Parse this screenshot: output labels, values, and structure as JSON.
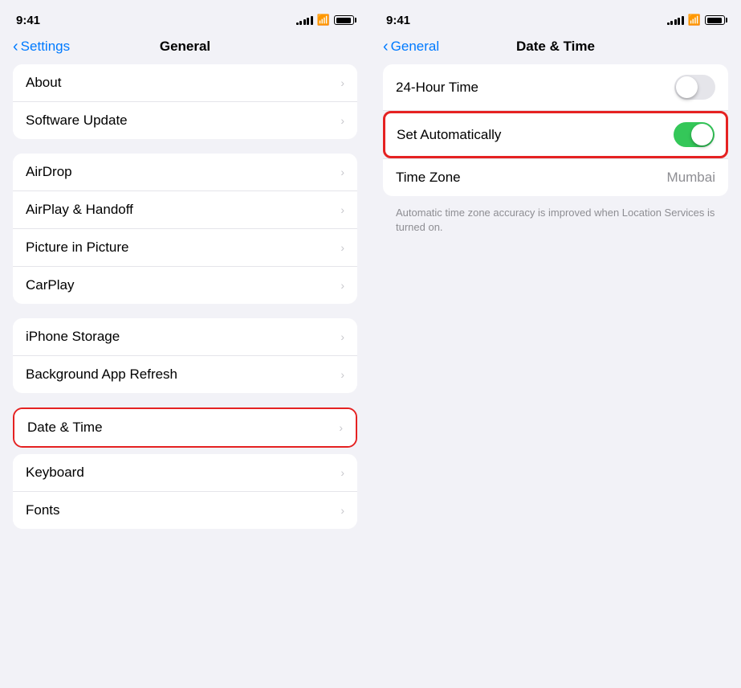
{
  "left_panel": {
    "status_bar": {
      "time": "9:41",
      "signal_bars": [
        3,
        5,
        7,
        9,
        11
      ],
      "wifi": "wifi",
      "battery": "battery"
    },
    "nav": {
      "back_label": "Settings",
      "title": "General"
    },
    "groups": [
      {
        "id": "group1",
        "items": [
          {
            "label": "About",
            "chevron": "›"
          },
          {
            "label": "Software Update",
            "chevron": "›"
          }
        ]
      },
      {
        "id": "group2",
        "items": [
          {
            "label": "AirDrop",
            "chevron": "›"
          },
          {
            "label": "AirPlay & Handoff",
            "chevron": "›"
          },
          {
            "label": "Picture in Picture",
            "chevron": "›"
          },
          {
            "label": "CarPlay",
            "chevron": "›"
          }
        ]
      },
      {
        "id": "group3",
        "items": [
          {
            "label": "iPhone Storage",
            "chevron": "›"
          },
          {
            "label": "Background App Refresh",
            "chevron": "›"
          }
        ]
      }
    ],
    "highlighted_item": {
      "label": "Date & Time",
      "chevron": "›"
    },
    "bottom_items": [
      {
        "label": "Keyboard",
        "chevron": "›"
      },
      {
        "label": "Fonts",
        "chevron": "›"
      }
    ]
  },
  "right_panel": {
    "status_bar": {
      "time": "9:41"
    },
    "nav": {
      "back_label": "General",
      "title": "Date & Time"
    },
    "rows": [
      {
        "id": "twenty-four-hour",
        "label": "24-Hour Time",
        "type": "toggle",
        "value": false
      },
      {
        "id": "set-automatically",
        "label": "Set Automatically",
        "type": "toggle",
        "value": true,
        "highlighted": true
      },
      {
        "id": "time-zone",
        "label": "Time Zone",
        "type": "value",
        "value": "Mumbai"
      }
    ],
    "hint": "Automatic time zone accuracy is improved when Location Services is turned on."
  }
}
